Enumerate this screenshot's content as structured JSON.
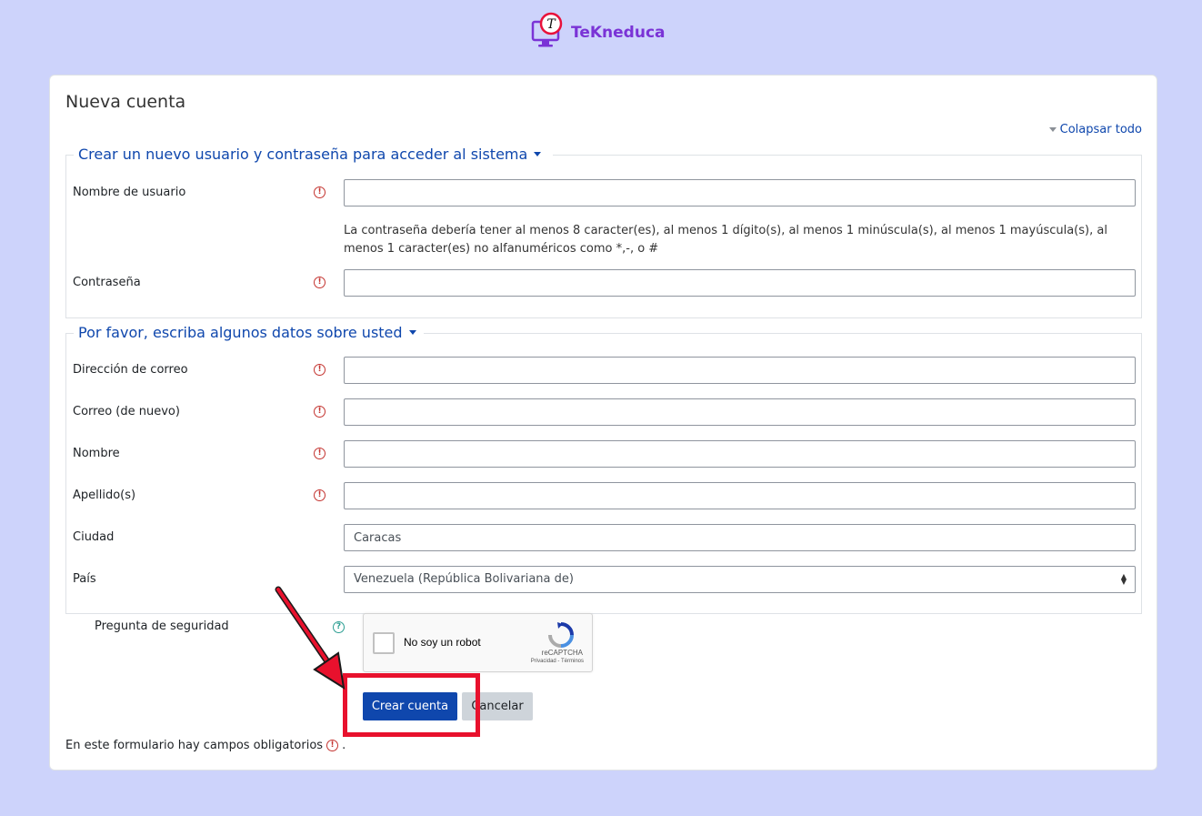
{
  "brand": {
    "name": "TeKneduca",
    "logo_glyph": "T",
    "color": "#7a33d6"
  },
  "page": {
    "title": "Nueva cuenta",
    "collapse_all": "Colapsar todo"
  },
  "section_account": {
    "legend": "Crear un nuevo usuario y contraseña para acceder al sistema",
    "username_label": "Nombre de usuario",
    "password_hint": "La contraseña debería tener al menos 8 caracter(es), al menos 1 dígito(s), al menos 1 minúscula(s), al menos 1 mayúscula(s), al menos 1 caracter(es) no alfanuméricos como *,-, o #",
    "password_label": "Contraseña"
  },
  "section_details": {
    "legend": "Por favor, escriba algunos datos sobre usted",
    "email_label": "Dirección de correo",
    "email2_label": "Correo (de nuevo)",
    "firstname_label": "Nombre",
    "lastname_label": "Apellido(s)",
    "city_label": "Ciudad",
    "city_value": "Caracas",
    "country_label": "País",
    "country_value": "Venezuela (República Bolivariana de)"
  },
  "required_icon_glyph": "!",
  "help_icon_glyph": "?",
  "security": {
    "label": "Pregunta de seguridad",
    "recaptcha_text": "No soy un robot",
    "recaptcha_brand": "reCAPTCHA",
    "recaptcha_links": "Privacidad - Términos"
  },
  "buttons": {
    "submit": "Crear cuenta",
    "cancel": "Cancelar"
  },
  "footer": {
    "required_note": "En este formulario hay campos obligatorios",
    "period": "."
  },
  "colors": {
    "accent": "#0f47ad",
    "background": "#cdd3fb",
    "highlight": "#e8112d",
    "required": "#c43430"
  }
}
